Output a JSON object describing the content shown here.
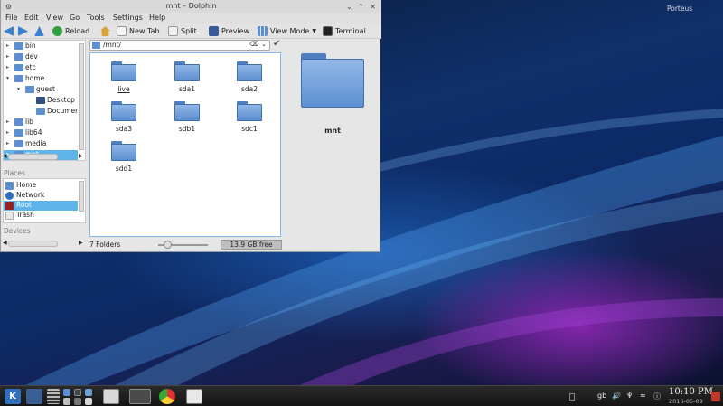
{
  "window": {
    "title": "mnt – Dolphin"
  },
  "menu": [
    "File",
    "Edit",
    "View",
    "Go",
    "Tools",
    "Settings",
    "Help"
  ],
  "toolbar": {
    "reload": "Reload",
    "new_tab": "New Tab",
    "split": "Split",
    "preview": "Preview",
    "view_mode": "View Mode",
    "terminal": "Terminal"
  },
  "tree": {
    "items": [
      {
        "label": "bin",
        "expander": "▸"
      },
      {
        "label": "dev",
        "expander": "▸"
      },
      {
        "label": "etc",
        "expander": "▸"
      },
      {
        "label": "home",
        "expander": "▾"
      },
      {
        "label": "guest",
        "expander": "▾"
      },
      {
        "label": "Desktop",
        "expander": ""
      },
      {
        "label": "Documer",
        "expander": ""
      },
      {
        "label": "lib",
        "expander": "▸"
      },
      {
        "label": "lib64",
        "expander": "▸"
      },
      {
        "label": "media",
        "expander": "▸"
      },
      {
        "label": "mnt",
        "expander": "▸"
      }
    ]
  },
  "places": {
    "header": "Places",
    "items": [
      {
        "label": "Home"
      },
      {
        "label": "Network"
      },
      {
        "label": "Root"
      },
      {
        "label": "Trash"
      }
    ]
  },
  "devices": {
    "header": "Devices"
  },
  "location": {
    "path": "/mnt/"
  },
  "folders": [
    "live",
    "sda1",
    "sda2",
    "sda3",
    "sdb1",
    "sdc1",
    "sdd1"
  ],
  "status": {
    "count": "7 Folders",
    "free": "13.9 GB free"
  },
  "info": {
    "name": "mnt"
  },
  "desktop": {
    "widget": "Porteus"
  },
  "taskbar": {
    "layout": "gb",
    "time": "10:10 PM",
    "date": "2016-05-09"
  },
  "colors": {
    "selection": "#5fb4ea",
    "folder": "#5c8fd0",
    "taskbar": "#1e1e1e"
  }
}
